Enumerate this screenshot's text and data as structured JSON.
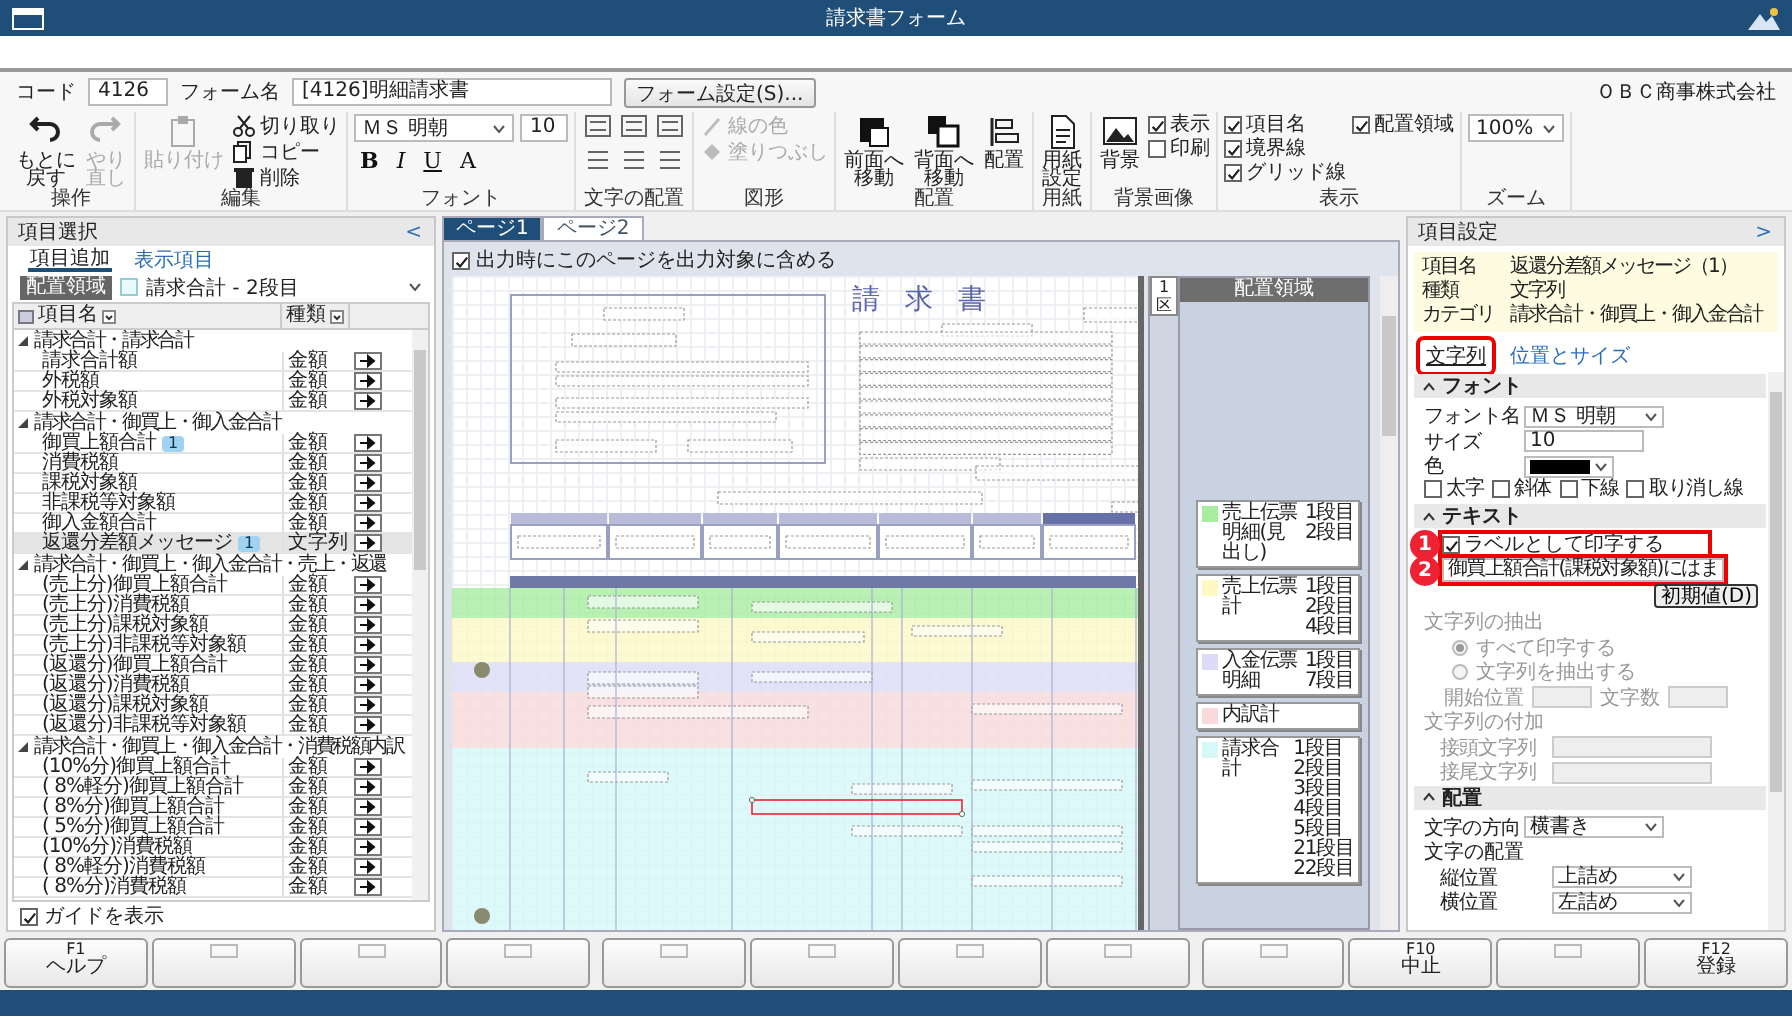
{
  "window": {
    "title": "請求書フォーム"
  },
  "company": "ＯＢＣ商事株式会社",
  "form_header": {
    "code_label": "コード",
    "code": "4126",
    "name_label": "フォーム名",
    "name": "[4126]明細請求書",
    "settings_button": "フォーム設定(S)..."
  },
  "ribbon": [
    {
      "label": "操作",
      "items": [
        {
          "kind": "big",
          "label": "もとに戻す",
          "two_line": true,
          "disabled": false
        },
        {
          "kind": "big",
          "label": "やり直し",
          "two_line": true,
          "disabled": true
        }
      ]
    },
    {
      "label": "編集",
      "items": [
        {
          "kind": "big",
          "label": "貼り付け",
          "two_line": false,
          "disabled": true
        },
        {
          "kind": "small",
          "label": "切り取り",
          "disabled": false
        },
        {
          "kind": "small",
          "label": "コピー",
          "disabled": false
        },
        {
          "kind": "small",
          "label": "削除",
          "disabled": false
        }
      ]
    },
    {
      "label": "フォント",
      "items": [
        {
          "kind": "font",
          "font": "ＭＳ 明朝",
          "size": "10",
          "formats": [
            "B",
            "I",
            "U",
            "A"
          ]
        }
      ]
    },
    {
      "label": "文字の配置",
      "items": [
        {
          "kind": "align"
        }
      ]
    },
    {
      "label": "図形",
      "items": [
        {
          "kind": "small",
          "label": "線の色",
          "disabled": true
        },
        {
          "kind": "small",
          "label": "塗りつぶし",
          "disabled": true
        }
      ]
    },
    {
      "label": "配置",
      "items": [
        {
          "kind": "big",
          "label": "前面へ移動",
          "two_line": true,
          "disabled": false
        },
        {
          "kind": "big",
          "label": "背面へ移動",
          "two_line": true,
          "disabled": false
        },
        {
          "kind": "big",
          "label": "配置",
          "two_line": false,
          "disabled": false
        }
      ]
    },
    {
      "label": "用紙",
      "items": [
        {
          "kind": "big",
          "label": "用紙設定",
          "two_line": true,
          "disabled": false
        }
      ]
    },
    {
      "label": "背景画像",
      "items": [
        {
          "kind": "big",
          "label": "背景",
          "two_line": false,
          "disabled": false
        },
        {
          "kind": "checks",
          "items": [
            {
              "label": "表示",
              "checked": true
            },
            {
              "label": "印刷",
              "checked": false
            }
          ]
        }
      ]
    },
    {
      "label": "表示",
      "items": [
        {
          "kind": "checks",
          "items": [
            {
              "label": "項目名",
              "checked": true
            },
            {
              "label": "境界線",
              "checked": true
            },
            {
              "label": "グリッド線",
              "checked": true
            }
          ]
        },
        {
          "kind": "checks",
          "items": [
            {
              "label": "配置領域",
              "checked": true
            }
          ]
        }
      ]
    },
    {
      "label": "ズーム",
      "items": [
        {
          "kind": "combo",
          "value": "100%"
        }
      ]
    }
  ],
  "item_panel": {
    "title": "項目選択",
    "collapse": "<",
    "tabs": [
      {
        "label": "項目追加",
        "selected": true
      },
      {
        "label": "表示項目",
        "selected": false
      }
    ],
    "region_label": "配置領域",
    "region_value": "請求合計 - 2段目",
    "columns": [
      "項目名",
      "種類"
    ],
    "groups": [
      {
        "label": "請求合計・請求合計",
        "expanded": true,
        "children": [
          {
            "name": "請求合計額",
            "type": "金額",
            "selected": false
          },
          {
            "name": "外税額",
            "type": "金額",
            "selected": false
          },
          {
            "name": "外税対象額",
            "type": "金額",
            "selected": false
          }
        ]
      },
      {
        "label": "請求合計・御買上・御入金合計",
        "expanded": true,
        "children": [
          {
            "name": "御買上額合計",
            "type": "金額",
            "badge": "1",
            "selected": false
          },
          {
            "name": "消費税額",
            "type": "金額",
            "selected": false
          },
          {
            "name": "課税対象額",
            "type": "金額",
            "selected": false
          },
          {
            "name": "非課税等対象額",
            "type": "金額",
            "selected": false
          },
          {
            "name": "御入金額合計",
            "type": "金額",
            "selected": false
          },
          {
            "name": "返還分差額メッセージ",
            "type": "文字列",
            "badge": "1",
            "selected": true
          }
        ]
      },
      {
        "label": "請求合計・御買上・御入金合計・売上・返還",
        "expanded": true,
        "children": [
          {
            "name": "(売上分)御買上額合計",
            "type": "金額",
            "selected": false
          },
          {
            "name": "(売上分)消費税額",
            "type": "金額",
            "selected": false
          },
          {
            "name": "(売上分)課税対象額",
            "type": "金額",
            "selected": false
          },
          {
            "name": "(売上分)非課税等対象額",
            "type": "金額",
            "selected": false
          },
          {
            "name": "(返還分)御買上額合計",
            "type": "金額",
            "selected": false
          },
          {
            "name": "(返還分)消費税額",
            "type": "金額",
            "selected": false
          },
          {
            "name": "(返還分)課税対象額",
            "type": "金額",
            "selected": false
          },
          {
            "name": "(返還分)非課税等対象額",
            "type": "金額",
            "selected": false
          }
        ]
      },
      {
        "label": "請求合計・御買上・御入金合計・消費税額内訳",
        "expanded": true,
        "children": [
          {
            "name": "(10%分)御買上額合計",
            "type": "金額",
            "selected": false
          },
          {
            "name": "( 8%軽分)御買上額合計",
            "type": "金額",
            "selected": false
          },
          {
            "name": "( 8%分)御買上額合計",
            "type": "金額",
            "selected": false
          },
          {
            "name": "( 5%分)御買上額合計",
            "type": "金額",
            "selected": false
          },
          {
            "name": "(10%分)消費税額",
            "type": "金額",
            "selected": false
          },
          {
            "name": "( 8%軽分)消費税額",
            "type": "金額",
            "selected": false
          },
          {
            "name": "( 8%分)消費税額",
            "type": "金額",
            "selected": false
          }
        ]
      }
    ],
    "guide": {
      "label": "ガイドを表示",
      "checked": true
    }
  },
  "designer": {
    "tabs": [
      {
        "label": "ページ1",
        "selected": true
      },
      {
        "label": "ページ2",
        "selected": false
      }
    ],
    "include_page": {
      "label": "出力時にこのページを出力対象に含める",
      "checked": true
    },
    "form_title": "請 求 書",
    "zone_header": "1区",
    "region_header": "配置領域",
    "regions": [
      {
        "label": "売上伝票明細(見出し)",
        "color": "#a8eca0",
        "rows": [
          "1段目",
          "2段目"
        ]
      },
      {
        "label": "売上伝票計",
        "color": "#fdf8c4",
        "rows": [
          "1段目",
          "2段目",
          "4段目"
        ]
      },
      {
        "label": "入金伝票明細",
        "color": "#dcdcf6",
        "rows": [
          "1段目",
          "7段目"
        ]
      },
      {
        "label": "内訳計",
        "color": "#f9d9d9"
      },
      {
        "label": "請求合計",
        "color": "#d6f8f8",
        "rows": [
          "1段目",
          "2段目",
          "3段目",
          "4段目",
          "5段目",
          "21段目",
          "22段目"
        ]
      }
    ]
  },
  "settings_panel": {
    "title": "項目設定",
    "collapse": ">",
    "info": [
      {
        "label": "項目名",
        "value": "返還分差額メッセージ（1）"
      },
      {
        "label": "種類",
        "value": "文字列"
      },
      {
        "label": "カテゴリ",
        "value": "請求合計・御買上・御入金合計"
      }
    ],
    "tabs": [
      {
        "label": "文字列",
        "selected": true,
        "highlighted": true
      },
      {
        "label": "位置とサイズ",
        "selected": false,
        "highlighted": false
      }
    ],
    "sections": [
      {
        "title": "フォント",
        "expanded": true,
        "rows": [
          {
            "kind": "select",
            "label": "フォント名",
            "value": "ＭＳ 明朝"
          },
          {
            "kind": "input",
            "label": "サイズ",
            "value": "10"
          },
          {
            "kind": "color",
            "label": "色",
            "color": "#000000"
          },
          {
            "kind": "checks",
            "items": [
              {
                "label": "太字",
                "checked": false
              },
              {
                "label": "斜体",
                "checked": false
              },
              {
                "label": "下線",
                "checked": false
              },
              {
                "label": "取り消し線",
                "checked": false
              }
            ]
          }
        ]
      },
      {
        "title": "テキスト",
        "expanded": true,
        "rows": [
          {
            "kind": "check",
            "label": "ラベルとして印字する",
            "checked": true,
            "highlighted": true,
            "badge": "1"
          },
          {
            "kind": "text_button",
            "value": "御買上額合計(課税対象額)にはま",
            "button": "初期値(D)",
            "highlighted": true,
            "badge": "2"
          },
          {
            "kind": "heading",
            "label": "文字列の抽出",
            "disabled": true
          },
          {
            "kind": "radio",
            "label": "すべて印字する",
            "selected": true,
            "disabled": true
          },
          {
            "kind": "radio",
            "label": "文字列を抽出する",
            "selected": false,
            "disabled": true
          },
          {
            "kind": "pair",
            "label": "開始位置",
            "label2": "文字数",
            "disabled": true
          },
          {
            "kind": "heading",
            "label": "文字列の付加",
            "disabled": true
          },
          {
            "kind": "input",
            "label": "接頭文字列",
            "disabled": true,
            "indent": true
          },
          {
            "kind": "input",
            "label": "接尾文字列",
            "disabled": true,
            "indent": true
          }
        ]
      },
      {
        "title": "配置",
        "expanded": true,
        "rows": [
          {
            "kind": "select",
            "label": "文字の方向",
            "value": "横書き"
          },
          {
            "kind": "heading",
            "label": "文字の配置",
            "disabled": false
          },
          {
            "kind": "select",
            "label": "縦位置",
            "value": "上詰め",
            "indent": true
          },
          {
            "kind": "select",
            "label": "横位置",
            "value": "左詰め",
            "indent": true
          }
        ]
      }
    ]
  },
  "function_keys": [
    {
      "kind": "key",
      "key": "F1",
      "label": "ヘルプ"
    },
    {
      "kind": "blank"
    },
    {
      "kind": "blank"
    },
    {
      "kind": "blank"
    },
    {
      "kind": "blank"
    },
    {
      "kind": "blank"
    },
    {
      "kind": "blank"
    },
    {
      "kind": "blank"
    },
    {
      "kind": "blank"
    },
    {
      "kind": "key",
      "key": "F10",
      "label": "中止"
    },
    {
      "kind": "blank"
    },
    {
      "kind": "key",
      "key": "F12",
      "label": "登録"
    }
  ]
}
